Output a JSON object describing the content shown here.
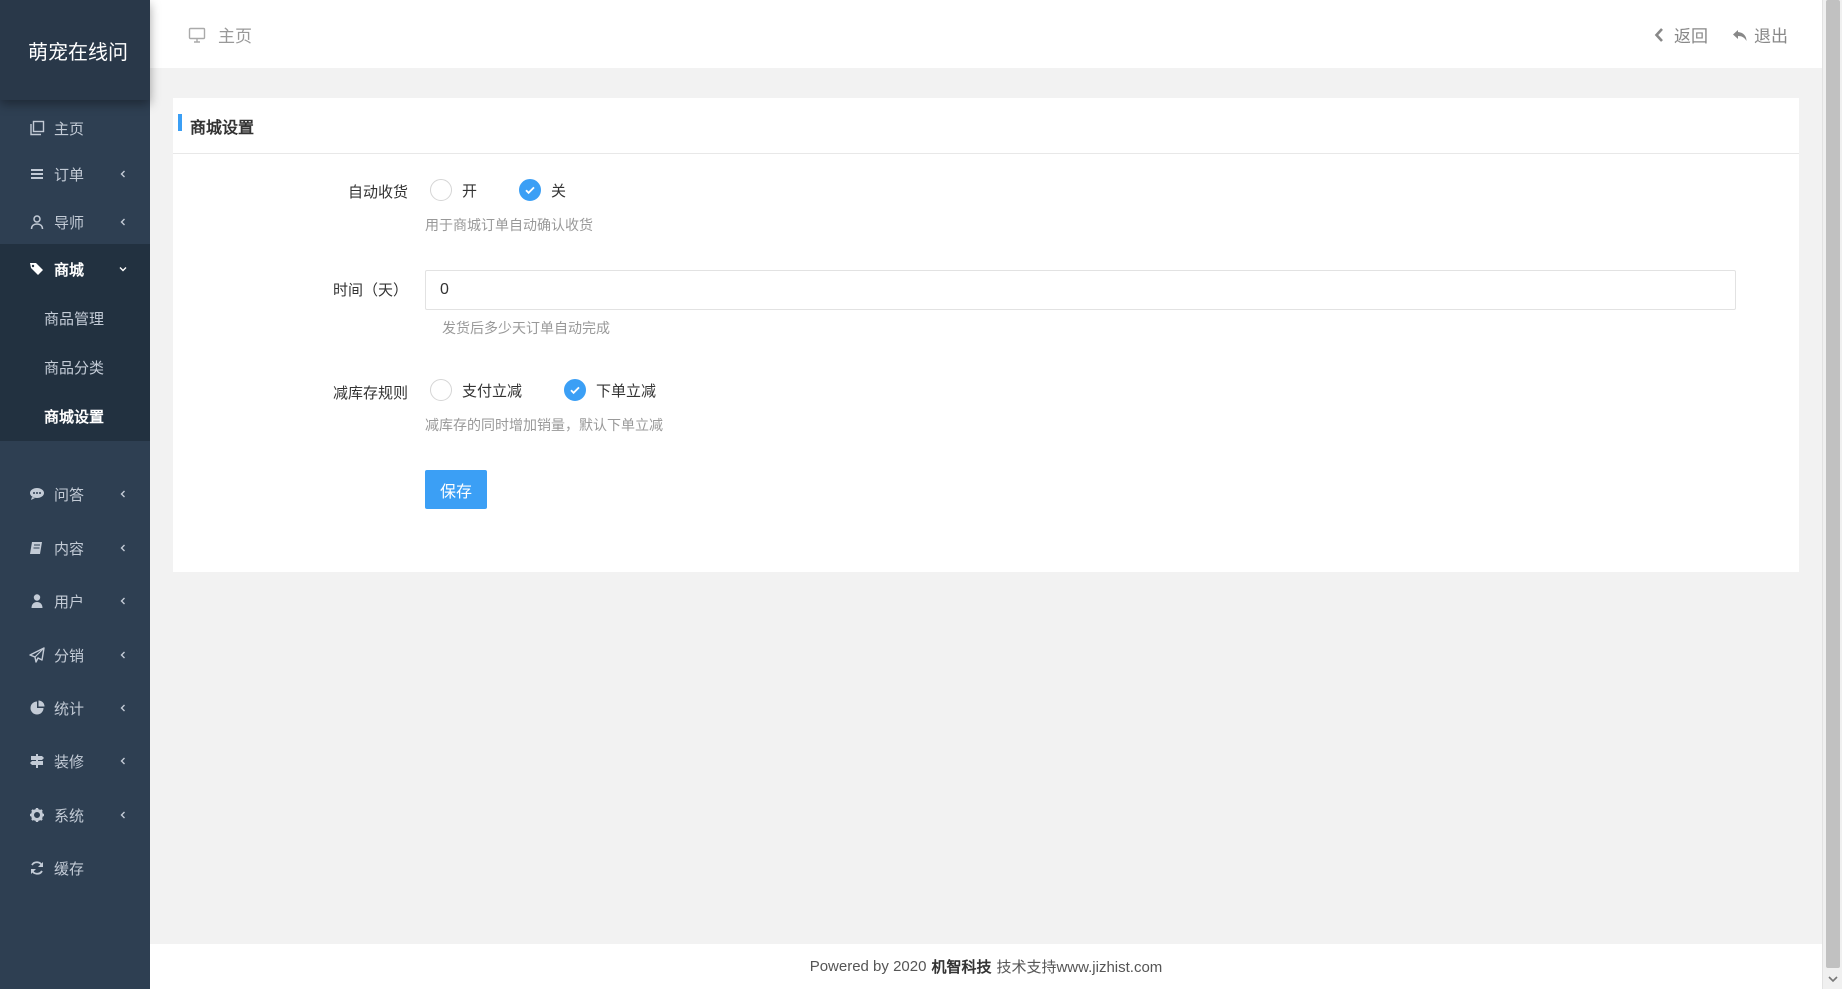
{
  "app": {
    "brand": "萌宠在线问"
  },
  "sidebar": {
    "items": [
      {
        "label": "主页",
        "icon": "copy-icon"
      },
      {
        "label": "订单",
        "icon": "list-icon"
      },
      {
        "label": "导师",
        "icon": "user-outline-icon"
      },
      {
        "label": "商城",
        "icon": "tags-icon"
      },
      {
        "label": "问答",
        "icon": "comment-icon"
      },
      {
        "label": "内容",
        "icon": "book-icon"
      },
      {
        "label": "用户",
        "icon": "user-icon"
      },
      {
        "label": "分销",
        "icon": "paper-plane-icon"
      },
      {
        "label": "统计",
        "icon": "pie-chart-icon"
      },
      {
        "label": "装修",
        "icon": "signpost-icon"
      },
      {
        "label": "系统",
        "icon": "gear-icon"
      },
      {
        "label": "缓存",
        "icon": "refresh-icon"
      }
    ],
    "shop_sub": [
      {
        "label": "商品管理"
      },
      {
        "label": "商品分类"
      },
      {
        "label": "商城设置"
      }
    ]
  },
  "header": {
    "crumb": "主页",
    "back_label": "返回",
    "logout_label": "退出"
  },
  "panel": {
    "title": "商城设置",
    "auto_receive": {
      "label": "自动收货",
      "options": [
        "开",
        "关"
      ],
      "selected": "关",
      "hint": "用于商城订单自动确认收货"
    },
    "days": {
      "label": "时间（天）",
      "value": "0",
      "hint": "发货后多少天订单自动完成"
    },
    "stock_rule": {
      "label": "减库存规则",
      "options": [
        "支付立减",
        "下单立减"
      ],
      "selected": "下单立减",
      "hint": "减库存的同时增加销量，默认下单立减"
    },
    "save_label": "保存"
  },
  "footer": {
    "prefix": "Powered by 2020",
    "company": "机智科技",
    "suffix": "技术支持www.jizhist.com"
  },
  "colors": {
    "sidebar_bg": "#2e3f52",
    "accent": "#3b9ff5"
  }
}
